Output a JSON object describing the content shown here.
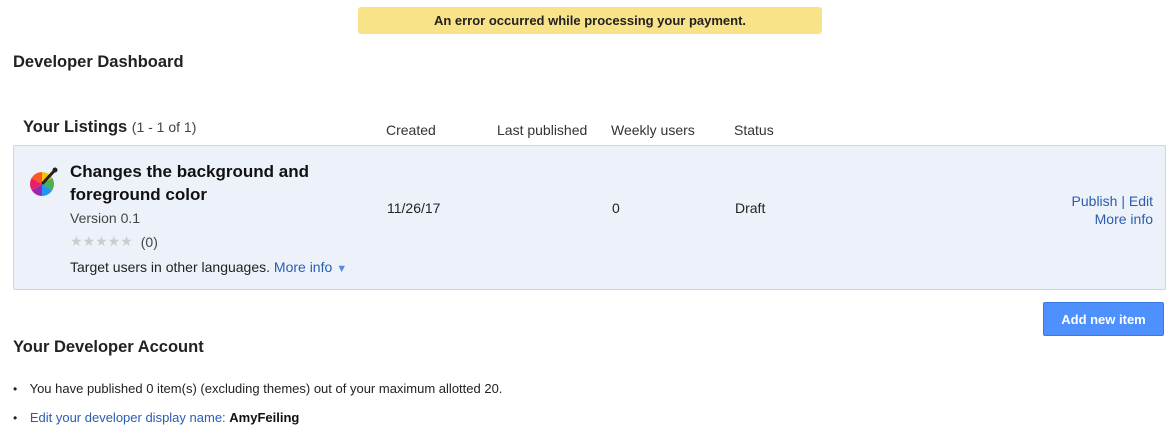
{
  "banner": {
    "error_text": "An error occurred while processing your payment."
  },
  "page": {
    "title": "Developer Dashboard"
  },
  "listings": {
    "title": "Your Listings",
    "count": "(1 - 1 of 1)",
    "columns": {
      "created": "Created",
      "last_published": "Last published",
      "weekly_users": "Weekly users",
      "status": "Status"
    },
    "items": [
      {
        "name": "Changes the background and foreground color",
        "version": "Version 0.1",
        "stars": "★★★★★",
        "rating_count": "(0)",
        "target_text": "Target users in other languages.",
        "target_link": "More info",
        "created": "11/26/17",
        "last_published": "",
        "weekly_users": "0",
        "status": "Draft",
        "actions": {
          "publish": "Publish",
          "separator": "|",
          "edit": "Edit",
          "more_info": "More info"
        }
      }
    ],
    "add_button": "Add new item"
  },
  "account": {
    "title": "Your Developer Account",
    "published_text": "You have published 0 item(s) (excluding themes) out of your maximum allotted 20.",
    "display_name_link": "Edit your developer display name:",
    "display_name": "AmyFeiling"
  },
  "colors": {
    "banner_bg": "#f9e389",
    "card_bg": "#edf2fa",
    "link": "#2a5db0",
    "button_bg": "#4d90fe"
  }
}
